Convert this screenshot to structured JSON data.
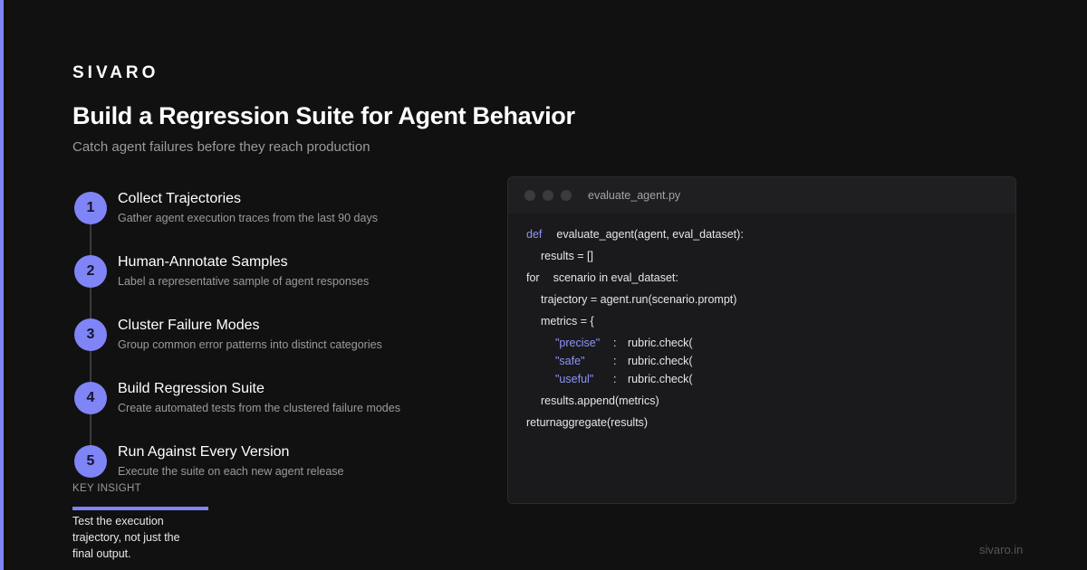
{
  "brand": "SIVARO",
  "title": "Build a Regression Suite for Agent Behavior",
  "subtitle": "Catch agent failures before they reach production",
  "steps": [
    {
      "number": "1",
      "title": "Collect Trajectories",
      "desc": "Gather agent execution traces from the last 90 days"
    },
    {
      "number": "2",
      "title": "Human-Annotate Samples",
      "desc": "Label a representative sample of agent responses"
    },
    {
      "number": "3",
      "title": "Cluster Failure Modes",
      "desc": "Group common error patterns into distinct categories"
    },
    {
      "number": "4",
      "title": "Build Regression Suite",
      "desc": "Create automated tests from the clustered failure modes"
    },
    {
      "number": "5",
      "title": "Run Against Every Version",
      "desc": "Execute the suite on each new agent release"
    }
  ],
  "insight": {
    "label": "KEY INSIGHT",
    "text": "Test the execution trajectory, not just the final output."
  },
  "code": {
    "filename": "evaluate_agent.py",
    "def_kw": "def",
    "def_sig": "evaluate_agent(agent, eval_dataset):",
    "results_init": "results = []",
    "for_kw": "for",
    "for_rest": "scenario in eval_dataset:",
    "trajectory": "trajectory = agent.run(scenario.prompt)",
    "metrics_open": "metrics = {",
    "m1_key": "\"precise\"",
    "m2_key": "\"safe\"",
    "m3_key": "\"useful\"",
    "colon": ":",
    "call": "rubric.check(",
    "append": "results.append(metrics)",
    "return_kw": "return",
    "return_rest": "aggregate(results)"
  },
  "footer_url": "sivaro.in",
  "colors": {
    "accent": "#7f84f6",
    "background": "#111111"
  }
}
